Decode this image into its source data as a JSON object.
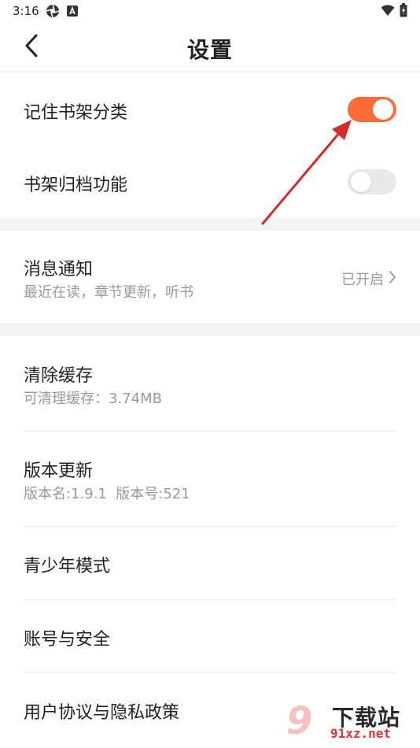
{
  "status_bar": {
    "time": "3:16",
    "left_icons": [
      "camera-aperture-icon",
      "accessibility-a-icon"
    ],
    "right_icons": [
      "wifi-icon",
      "battery-charging-icon"
    ]
  },
  "header": {
    "title": "设置",
    "back_icon": "chevron-left-icon"
  },
  "settings": {
    "remember_shelf": {
      "label": "记住书架分类",
      "enabled": true
    },
    "shelf_archive": {
      "label": "书架归档功能",
      "enabled": false
    },
    "notifications": {
      "label": "消息通知",
      "subtitle": "最近在读，章节更新，听书",
      "value": "已开启"
    },
    "clear_cache": {
      "label": "清除缓存",
      "subtitle": "可清理缓存：3.74MB"
    },
    "version": {
      "label": "版本更新",
      "subtitle": "版本名:1.9.1  版本号:521"
    },
    "teen_mode": {
      "label": "青少年模式"
    },
    "account_security": {
      "label": "账号与安全"
    },
    "agreement": {
      "label": "用户协议与隐私政策"
    }
  },
  "colors": {
    "accent": "#ff6b35",
    "annotation_arrow": "#d42a2a"
  },
  "watermark": {
    "title": "下载站",
    "domain": "91xz.net"
  }
}
